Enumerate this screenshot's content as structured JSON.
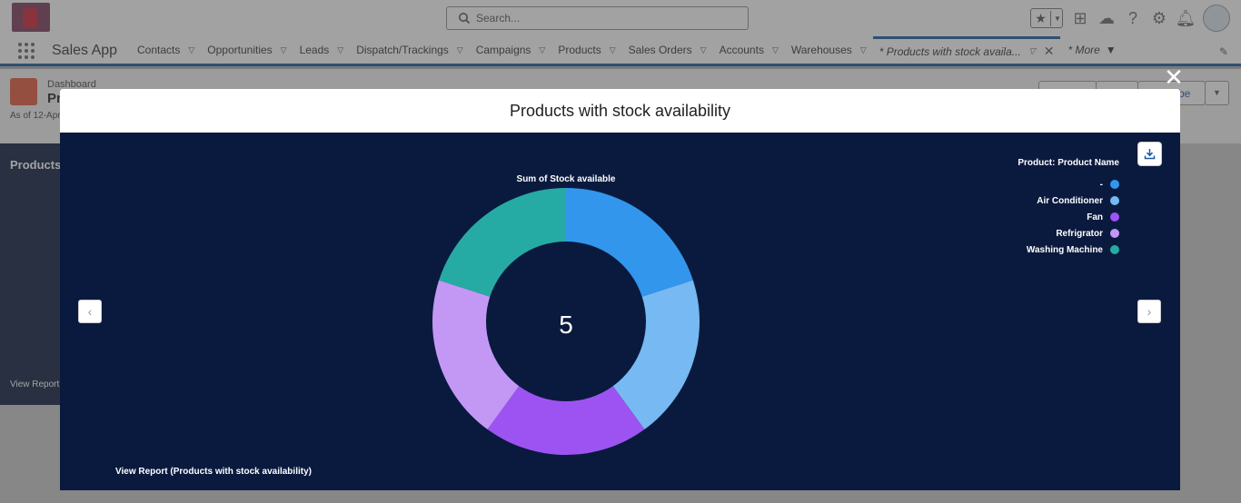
{
  "topbar": {
    "search_placeholder": "Search..."
  },
  "navbar": {
    "app_name": "Sales App",
    "tabs": [
      {
        "label": "Contacts"
      },
      {
        "label": "Opportunities"
      },
      {
        "label": "Leads"
      },
      {
        "label": "Dispatch/Trackings"
      },
      {
        "label": "Campaigns"
      },
      {
        "label": "Products"
      },
      {
        "label": "Sales Orders"
      },
      {
        "label": "Accounts"
      },
      {
        "label": "Warehouses"
      }
    ],
    "active_tab": "* Products with stock availa...",
    "more_label": "* More"
  },
  "page_header": {
    "type_label": "Dashboard",
    "title": "Pr",
    "as_of": "As of 12-Apr",
    "subscribe_partial": "be"
  },
  "background_card": {
    "title": "Products",
    "link": "View Report"
  },
  "modal": {
    "title": "Products with stock availability",
    "view_report_link": "View Report (Products with stock availability)",
    "center_value": "5"
  },
  "chart_data": {
    "type": "donut",
    "title": "Sum of Stock available",
    "legend_title": "Product: Product Name",
    "legend_position": "top-right",
    "total": 5,
    "categories": [
      "-",
      "Air Conditioner",
      "Fan",
      "Refrigrator",
      "Washing Machine"
    ],
    "values": [
      1,
      1,
      1,
      1,
      1
    ],
    "colors": [
      "#3296ed",
      "#77b9f2",
      "#9d53f2",
      "#c398f5",
      "#26aba4"
    ]
  }
}
